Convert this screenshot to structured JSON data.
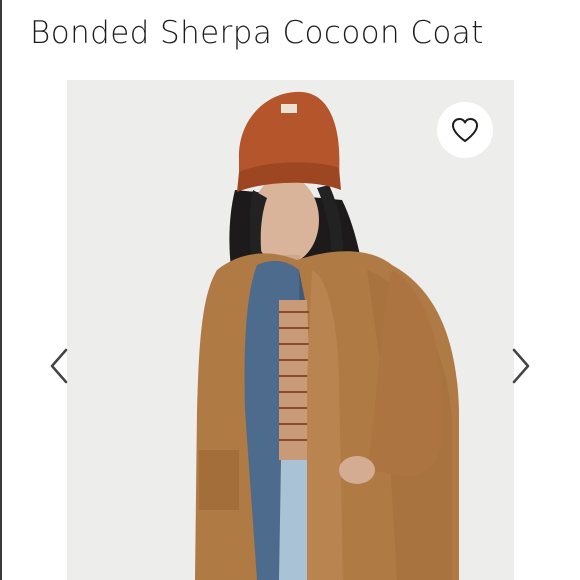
{
  "product": {
    "title": "Bonded Sherpa Cocoon Coat"
  },
  "gallery": {
    "image_subject": "model wearing camel sherpa coat, denim jacket, striped top and rust beanie",
    "prev_icon": "chevron-left-icon",
    "next_icon": "chevron-right-icon",
    "favorite_icon": "heart-outline-icon"
  },
  "colors": {
    "title_text": "#1c1c1c",
    "photo_background": "#ededec",
    "coat": "#b07a45",
    "beanie": "#b5552c",
    "denim": "#4d6b8c"
  }
}
